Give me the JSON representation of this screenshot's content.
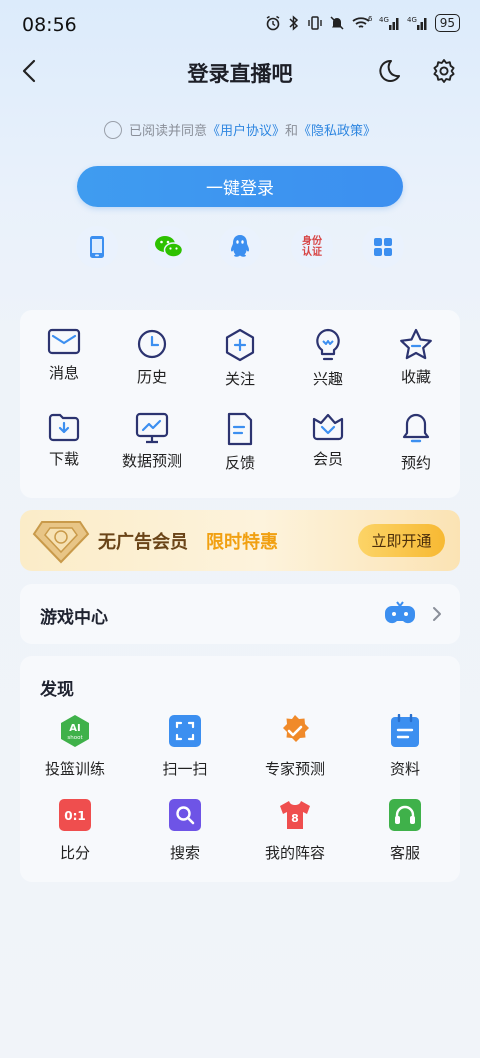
{
  "status": {
    "time": "08:56",
    "battery": "95",
    "net1": "4G",
    "net2": "4G",
    "wifi_mark": "6"
  },
  "header": {
    "title": "登录直播吧"
  },
  "agreement": {
    "prefix": "已阅读并同意",
    "user_agreement": "《用户协议》",
    "and": "和",
    "privacy": "《隐私政策》"
  },
  "login": {
    "button_label": "一键登录",
    "methods": [
      {
        "icon": "phone-icon"
      },
      {
        "icon": "wechat-icon"
      },
      {
        "icon": "qq-icon"
      },
      {
        "icon": "id-verify-icon",
        "text_line1": "身份",
        "text_line2": "认证"
      },
      {
        "icon": "more-apps-icon"
      }
    ]
  },
  "grid": {
    "items": [
      {
        "label": "消息",
        "icon": "mail-icon"
      },
      {
        "label": "历史",
        "icon": "clock-icon"
      },
      {
        "label": "关注",
        "icon": "follow-icon"
      },
      {
        "label": "兴趣",
        "icon": "bulb-icon"
      },
      {
        "label": "收藏",
        "icon": "star-icon"
      },
      {
        "label": "下载",
        "icon": "download-icon"
      },
      {
        "label": "数据预测",
        "icon": "chart-icon"
      },
      {
        "label": "反馈",
        "icon": "feedback-icon"
      },
      {
        "label": "会员",
        "icon": "vip-icon"
      },
      {
        "label": "预约",
        "icon": "bell-icon"
      }
    ]
  },
  "vip_banner": {
    "text": "无广告会员",
    "promo": "限时特惠",
    "button": "立即开通"
  },
  "game_center": {
    "title": "游戏中心"
  },
  "discover": {
    "title": "发现",
    "items": [
      {
        "label": "投篮训练",
        "icon": "ai-shoot-icon",
        "badge": "AI",
        "badge_sub": "shoot"
      },
      {
        "label": "扫一扫",
        "icon": "scan-icon"
      },
      {
        "label": "专家预测",
        "icon": "expert-icon"
      },
      {
        "label": "资料",
        "icon": "data-icon"
      },
      {
        "label": "比分",
        "icon": "score-icon",
        "badge": "0:1"
      },
      {
        "label": "搜索",
        "icon": "search-icon"
      },
      {
        "label": "我的阵容",
        "icon": "jersey-icon",
        "badge": "8"
      },
      {
        "label": "客服",
        "icon": "headset-icon"
      }
    ]
  },
  "colors": {
    "accent": "#3c8ff0",
    "link": "#2e86e0",
    "icon_dark": "#2c3470",
    "vip_gold": "#f1a012"
  }
}
